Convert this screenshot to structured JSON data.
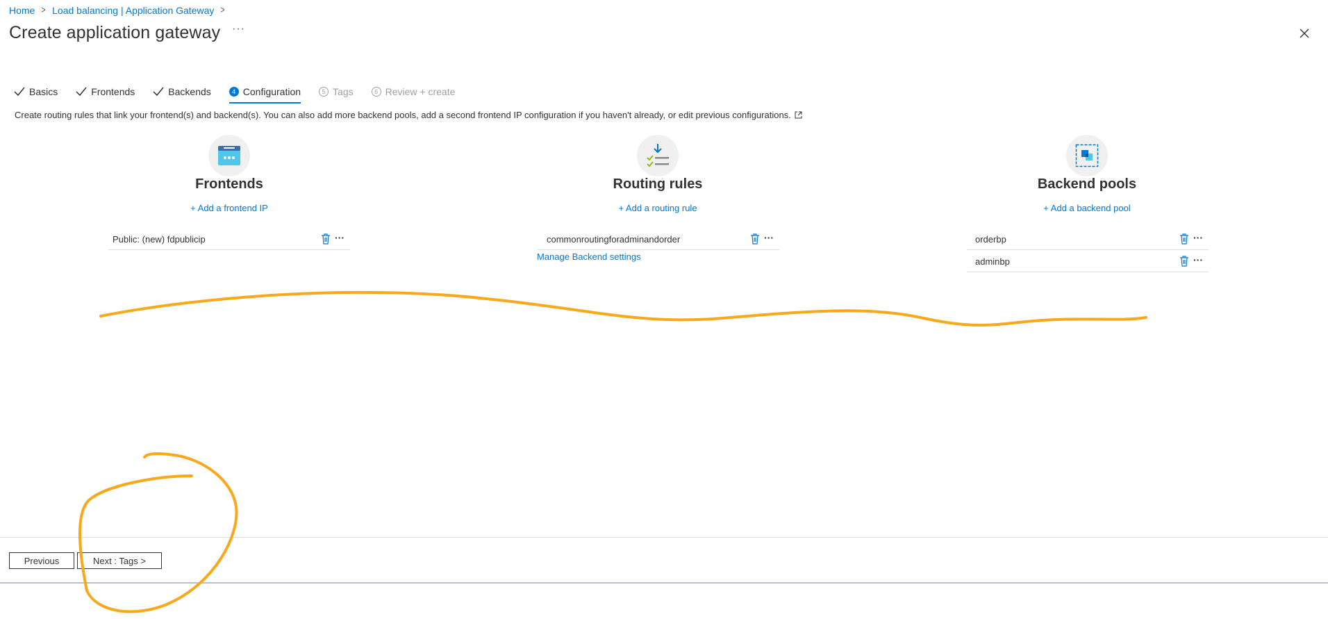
{
  "breadcrumb": {
    "items": [
      "Home",
      "Load balancing | Application Gateway"
    ]
  },
  "page": {
    "title": "Create application gateway",
    "more": "···"
  },
  "tabs": [
    {
      "label": "Basics",
      "state": "done"
    },
    {
      "label": "Frontends",
      "state": "done"
    },
    {
      "label": "Backends",
      "state": "done"
    },
    {
      "label": "Configuration",
      "state": "active",
      "number": "4"
    },
    {
      "label": "Tags",
      "state": "future",
      "number": "5"
    },
    {
      "label": "Review + create",
      "state": "future",
      "number": "6"
    }
  ],
  "description": "Create routing rules that link your frontend(s) and backend(s). You can also add more backend pools, add a second frontend IP configuration if you haven't already, or edit previous configurations.",
  "frontends": {
    "heading": "Frontends",
    "add_link": "+ Add a frontend IP",
    "items": [
      "Public: (new) fdpublicip"
    ],
    "icon": "frontend-window-icon"
  },
  "routing": {
    "heading": "Routing rules",
    "add_link": "+ Add a routing rule",
    "items": [
      "commonroutingforadminandorder"
    ],
    "manage_link": "Manage Backend settings",
    "icon": "routing-rules-icon"
  },
  "backends": {
    "heading": "Backend pools",
    "add_link": "+ Add a backend pool",
    "items": [
      "orderbp",
      "adminbp"
    ],
    "icon": "backend-pool-icon"
  },
  "footer": {
    "previous": "Previous",
    "next": "Next : Tags >"
  },
  "colors": {
    "accent": "#0078d4",
    "annotation": "#f7a81b"
  }
}
